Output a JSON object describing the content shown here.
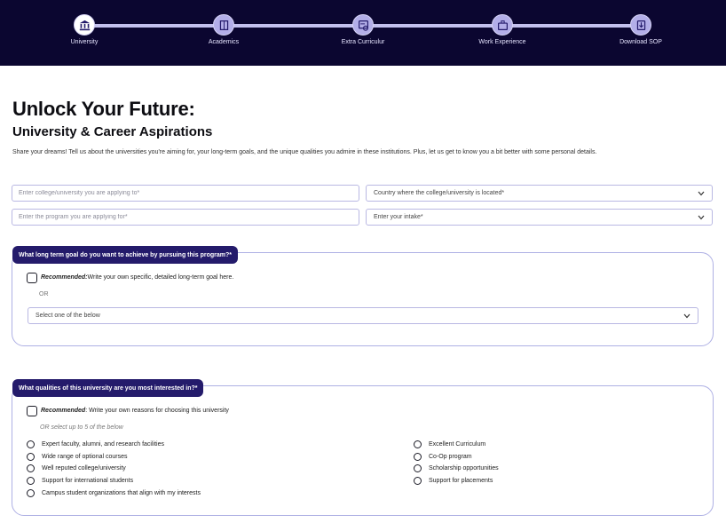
{
  "stepper": {
    "steps": [
      {
        "label": "University",
        "icon": "university-icon",
        "active": true
      },
      {
        "label": "Academics",
        "icon": "book-icon",
        "active": false
      },
      {
        "label": "Extra Curriculur",
        "icon": "activity-icon",
        "active": false
      },
      {
        "label": "Work Experience",
        "icon": "briefcase-icon",
        "active": false
      },
      {
        "label": "Download SOP",
        "icon": "download-icon",
        "active": false
      }
    ]
  },
  "page": {
    "title": "Unlock Your Future:",
    "subtitle": "University & Career Aspirations",
    "intro": "Share your dreams! Tell us about the universities you're aiming for, your long-term goals, and the unique qualities you admire in these institutions. Plus, let us get to know you a bit better with some personal details."
  },
  "form": {
    "college_placeholder": "Enter college/university you are applying to*",
    "country_placeholder": "Country where the college/university is located*",
    "program_placeholder": "Enter the program you are applying for*",
    "intake_placeholder": "Enter your intake*"
  },
  "goal_section": {
    "question": "What long term goal do you want to achieve by pursuing this program?*",
    "recommended_label": "Recommended:",
    "recommended_text": "Write your own specific, detailed long-term goal here.",
    "or_text": "OR",
    "select_placeholder": "Select one of the below"
  },
  "qualities_section": {
    "question": "What qualities of this university are you most interested in?*",
    "recommended_label": "Recommended",
    "recommended_text": ": Write your own reasons for choosing this university",
    "or_text": "OR select up to 5 of the below",
    "options_left": [
      "Expert faculty, alumni, and research facilities",
      "Wide range of optional courses",
      "Well reputed college/university",
      "Support for international students",
      "Campus student organizations that align with my interests"
    ],
    "options_right": [
      "Excellent Curriculum",
      "Co-Op program",
      "Scholarship opportunities",
      "Support for placements"
    ]
  },
  "colors": {
    "header_bg": "#0b0630",
    "tab_bg": "#241b6b",
    "border": "#aeb0e4"
  }
}
